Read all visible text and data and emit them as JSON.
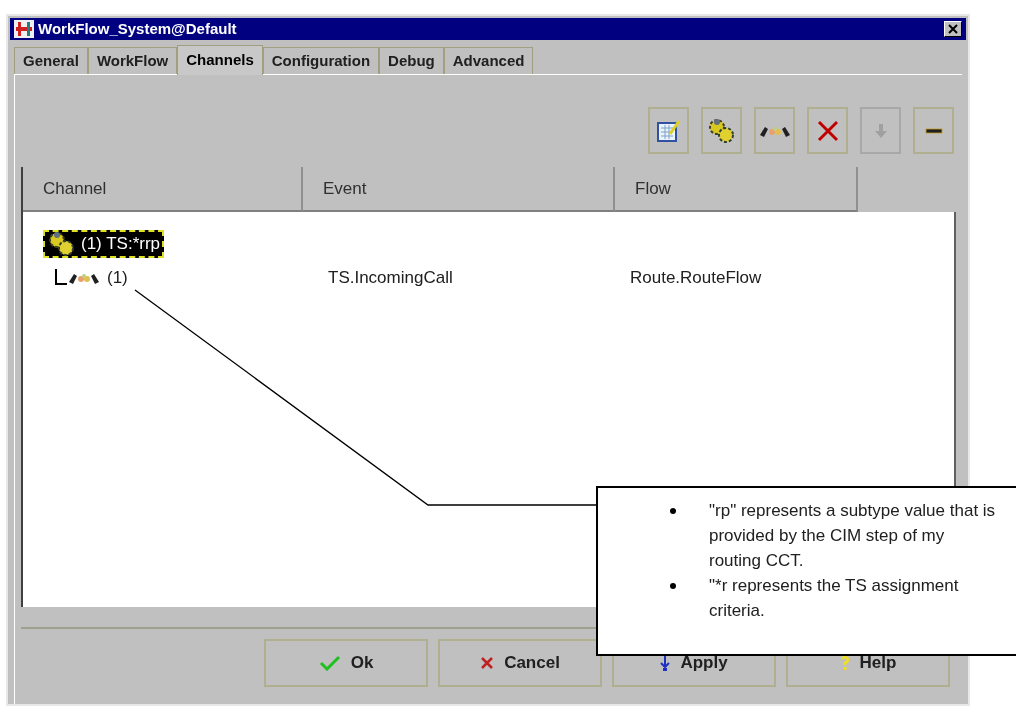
{
  "window": {
    "title": "WorkFlow_System@Default"
  },
  "tabs": [
    {
      "label": "General",
      "selected": false
    },
    {
      "label": "WorkFlow",
      "selected": false
    },
    {
      "label": "Channels",
      "selected": true
    },
    {
      "label": "Configuration",
      "selected": false
    },
    {
      "label": "Debug",
      "selected": false
    },
    {
      "label": "Advanced",
      "selected": false
    }
  ],
  "toolbar": [
    {
      "kind": "edit",
      "disabled": false
    },
    {
      "kind": "gears",
      "disabled": false
    },
    {
      "kind": "handshake",
      "disabled": false
    },
    {
      "kind": "delete",
      "disabled": false
    },
    {
      "kind": "down",
      "disabled": true
    },
    {
      "kind": "minus",
      "disabled": false
    }
  ],
  "table": {
    "columns": [
      "Channel",
      "Event",
      "Flow"
    ],
    "tree": [
      {
        "label": "(1) TS:*rrp",
        "kind": "gears",
        "selected": true,
        "children": [
          {
            "label": "(1)",
            "kind": "handshake",
            "selected": false,
            "event": "TS.IncomingCall",
            "flow": "Route.RouteFlow"
          }
        ]
      }
    ]
  },
  "buttons": [
    {
      "label": "Ok",
      "kind": "ok"
    },
    {
      "label": "Cancel",
      "kind": "cancel"
    },
    {
      "label": "Apply",
      "kind": "apply"
    },
    {
      "label": "Help",
      "kind": "help"
    }
  ],
  "callout": {
    "bullets": [
      "\"rp\" represents a subtype value that is provided by the CIM step of my routing CCT.",
      "\"*r represents the TS assignment criteria."
    ]
  }
}
